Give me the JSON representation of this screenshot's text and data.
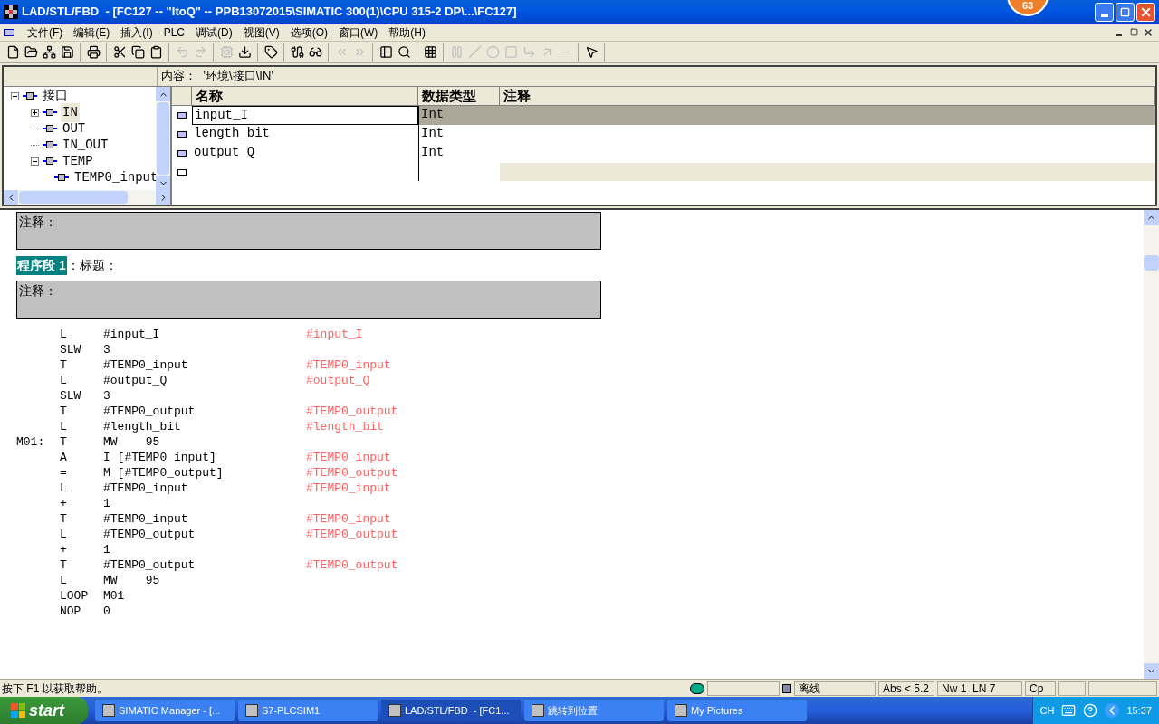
{
  "window": {
    "title": "LAD/STL/FBD  - [FC127 -- \"ItoQ\" -- PPB13072015\\SIMATIC 300(1)\\CPU 315-2 DP\\...\\FC127]",
    "badge": "63"
  },
  "menu": [
    "文件(F)",
    "编辑(E)",
    "插入(I)",
    "PLC",
    "调试(D)",
    "视图(V)",
    "选项(O)",
    "窗口(W)",
    "帮助(H)"
  ],
  "toolbar": [
    {
      "disabled": false
    },
    {
      "disabled": false
    },
    {
      "disabled": false
    },
    {
      "disabled": false
    },
    {
      "disabled": false
    },
    {
      "disabled": false
    },
    {
      "disabled": false
    },
    {
      "disabled": false
    },
    {
      "disabled": true
    },
    {
      "disabled": true
    },
    {
      "disabled": true
    },
    {
      "disabled": false
    },
    {
      "disabled": false
    },
    {
      "disabled": false
    },
    {
      "disabled": false
    },
    {
      "disabled": true
    },
    {
      "disabled": true
    },
    {
      "disabled": false
    },
    {
      "disabled": false
    },
    {
      "disabled": false
    },
    {
      "disabled": true
    },
    {
      "disabled": true
    },
    {
      "disabled": true
    },
    {
      "disabled": true
    },
    {
      "disabled": true
    },
    {
      "disabled": true
    },
    {
      "disabled": true
    },
    {
      "disabled": false
    }
  ],
  "interface": {
    "content_label": "内容：  ’环境\\接口\\IN’",
    "tree": [
      {
        "label": "接口",
        "expanded": true,
        "selected": false,
        "children": [
          {
            "label": "IN",
            "expanded": false,
            "selected": true
          },
          {
            "label": "OUT",
            "selected": false
          },
          {
            "label": "IN_OUT",
            "selected": false
          },
          {
            "label": "TEMP",
            "expanded": true,
            "selected": false,
            "children": [
              {
                "label": "TEMP0_input",
                "selected": false
              }
            ]
          }
        ]
      }
    ],
    "columns": [
      "名称",
      "数据类型",
      "注释"
    ],
    "rows": [
      {
        "name": "input_I",
        "type": "Int",
        "selected": true
      },
      {
        "name": "length_bit",
        "type": "Int",
        "selected": false
      },
      {
        "name": "output_Q",
        "type": "Int",
        "selected": false
      }
    ]
  },
  "editor": {
    "block_comment_label": "注释：",
    "network_label": "程序段 1",
    "network_title": "：标题：",
    "network_comment_label": "注释：",
    "lines": [
      {
        "op": "L",
        "operand": "#input_I",
        "comment": "#input_I"
      },
      {
        "op": "SLW",
        "operand": "3"
      },
      {
        "op": "T",
        "operand": "#TEMP0_input",
        "comment": "#TEMP0_input"
      },
      {
        "op": "L",
        "operand": "#output_Q",
        "comment": "#output_Q"
      },
      {
        "op": "SLW",
        "operand": "3"
      },
      {
        "op": "T",
        "operand": "#TEMP0_output",
        "comment": "#TEMP0_output"
      },
      {
        "op": "L",
        "operand": "#length_bit",
        "comment": "#length_bit"
      },
      {
        "label": "M01:",
        "op": "T",
        "operand": "MW    95"
      },
      {
        "op": "A",
        "operand": "I [#TEMP0_input]",
        "comment": "#TEMP0_input"
      },
      {
        "op": "=",
        "operand": "M [#TEMP0_output]",
        "comment": "#TEMP0_output"
      },
      {
        "op": "L",
        "operand": "#TEMP0_input",
        "comment": "#TEMP0_input"
      },
      {
        "op": "+",
        "operand": "1"
      },
      {
        "op": "T",
        "operand": "#TEMP0_input",
        "comment": "#TEMP0_input"
      },
      {
        "op": "L",
        "operand": "#TEMP0_output",
        "comment": "#TEMP0_output"
      },
      {
        "op": "+",
        "operand": "1"
      },
      {
        "op": "T",
        "operand": "#TEMP0_output",
        "comment": "#TEMP0_output"
      },
      {
        "op": "L",
        "operand": "MW    95"
      },
      {
        "op": "LOOP",
        "operand": "M01"
      },
      {
        "op": "NOP",
        "operand": "0"
      }
    ]
  },
  "status_bar": {
    "help": "按下 F1 以获取帮助。",
    "mode": "离线",
    "version": "Abs < 5.2",
    "position": "Nw 1  LN 7",
    "insert_mode": "Cp"
  },
  "taskbar": {
    "start": "start",
    "tasks": [
      {
        "label": "SIMATIC Manager - [...",
        "selected": false
      },
      {
        "label": "S7-PLCSIM1",
        "selected": false
      },
      {
        "label": "LAD/STL/FBD  - [FC1...",
        "selected": true
      },
      {
        "label": "跳转到位置",
        "selected": false
      },
      {
        "label": "My Pictures",
        "selected": false
      }
    ],
    "language": "CH",
    "time": "15:37"
  }
}
